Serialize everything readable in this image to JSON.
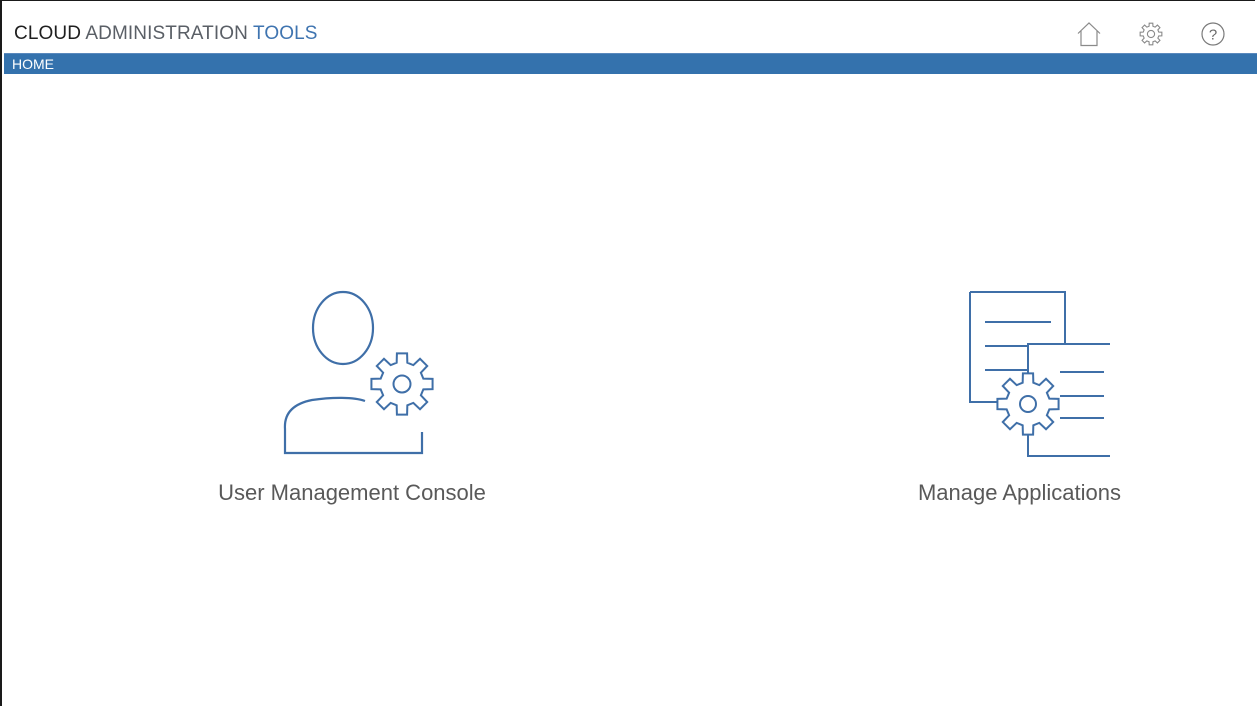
{
  "header": {
    "title_part1": "CLOUD",
    "title_part2": "ADMINISTRATION",
    "title_part3": "TOOLS",
    "icons": [
      {
        "name": "home-icon"
      },
      {
        "name": "gear-icon"
      },
      {
        "name": "help-icon"
      }
    ]
  },
  "breadcrumb": {
    "current": "HOME"
  },
  "tiles": [
    {
      "label": "User Management Console",
      "icon": "user-gear-icon"
    },
    {
      "label": "Manage Applications",
      "icon": "documents-gear-icon"
    }
  ],
  "colors": {
    "accent": "#3472ad",
    "icon_stroke": "#3f6fa8",
    "title_dark": "#1f1f1f",
    "title_gray": "#5a5f66",
    "title_blue": "#3f74b0"
  }
}
